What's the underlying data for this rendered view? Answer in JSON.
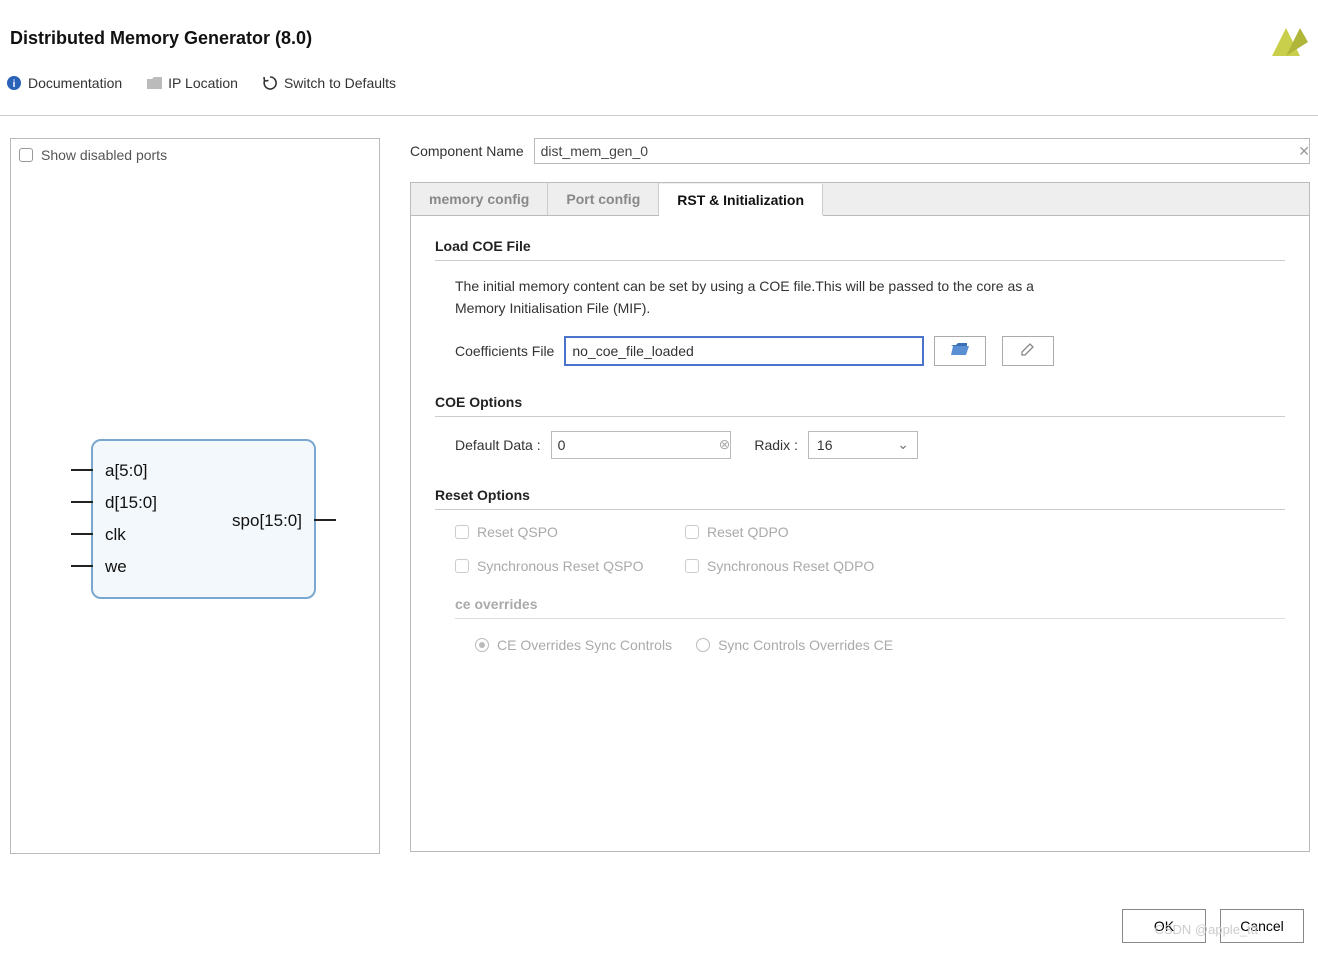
{
  "title": "Distributed Memory Generator (8.0)",
  "toolbar": {
    "documentation": "Documentation",
    "ip_location": "IP Location",
    "switch_defaults": "Switch to Defaults"
  },
  "preview": {
    "show_disabled_ports": "Show disabled ports",
    "ports_in": [
      "a[5:0]",
      "d[15:0]",
      "clk",
      "we"
    ],
    "ports_out": [
      "spo[15:0]"
    ]
  },
  "component_name_label": "Component Name",
  "component_name_value": "dist_mem_gen_0",
  "tabs": [
    "memory config",
    "Port config",
    "RST & Initialization"
  ],
  "active_tab": 2,
  "load_coe": {
    "title": "Load COE File",
    "text": "The initial memory content can be set by using a COE file.This will be passed to the core as a Memory Initialisation File (MIF).",
    "field_label": "Coefficients File",
    "field_value": "no_coe_file_loaded"
  },
  "coe_options": {
    "title": "COE Options",
    "default_data_label": "Default Data :",
    "default_data_value": "0",
    "radix_label": "Radix :",
    "radix_value": "16"
  },
  "reset_options": {
    "title": "Reset Options",
    "items": [
      "Reset QSPO",
      "Reset QDPO",
      "Synchronous Reset QSPO",
      "Synchronous Reset QDPO"
    ]
  },
  "ce_overrides": {
    "title": "ce overrides",
    "opt1": "CE Overrides Sync Controls",
    "opt2": "Sync Controls Overrides CE"
  },
  "buttons": {
    "ok": "OK",
    "cancel": "Cancel"
  },
  "watermark": "CSDN @apple_ttt"
}
